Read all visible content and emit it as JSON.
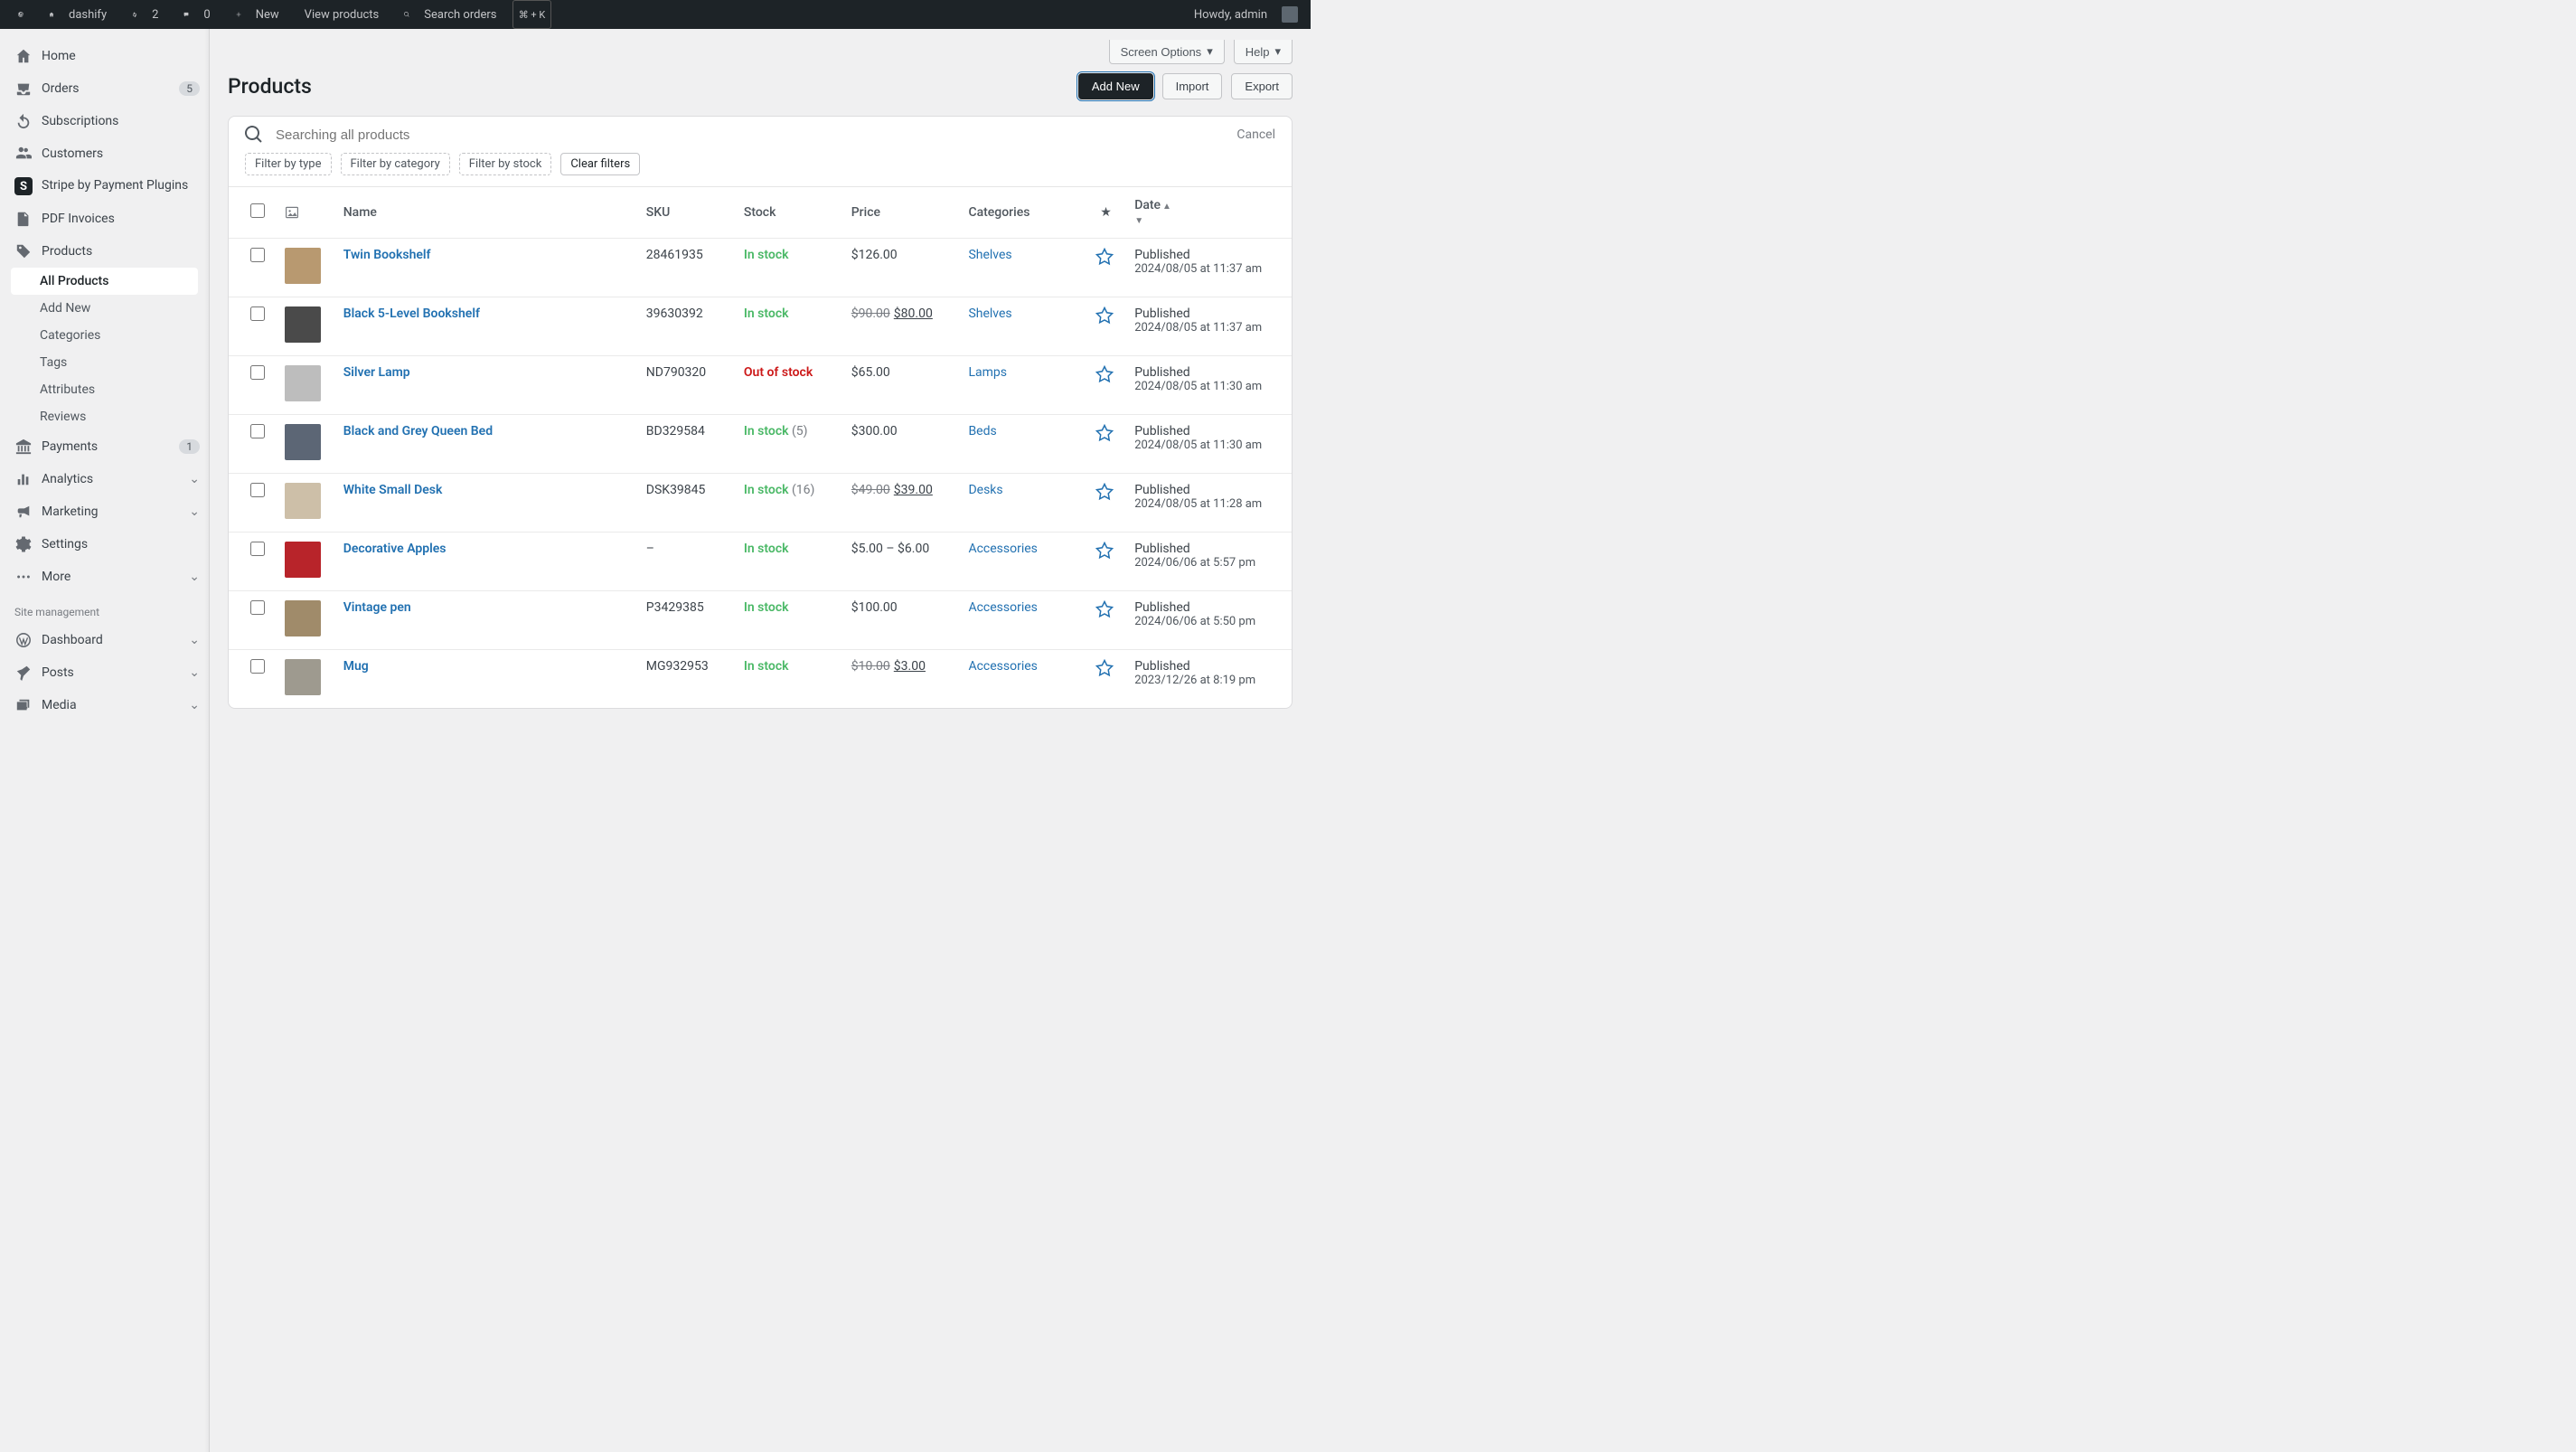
{
  "topbar": {
    "site_name": "dashify",
    "sync_count": "2",
    "comments_count": "0",
    "new_label": "New",
    "view_products": "View products",
    "search_label": "Search orders",
    "search_kbd": "⌘ + K",
    "howdy": "Howdy, admin"
  },
  "sidebar": {
    "home": "Home",
    "orders": "Orders",
    "orders_badge": "5",
    "subscriptions": "Subscriptions",
    "customers": "Customers",
    "stripe": "Stripe by Payment Plugins",
    "pdf": "PDF Invoices",
    "products": "Products",
    "sub": {
      "all": "All Products",
      "add": "Add New",
      "categories": "Categories",
      "tags": "Tags",
      "attributes": "Attributes",
      "reviews": "Reviews"
    },
    "payments": "Payments",
    "payments_badge": "1",
    "analytics": "Analytics",
    "marketing": "Marketing",
    "settings": "Settings",
    "more": "More",
    "section": "Site management",
    "dashboard": "Dashboard",
    "posts": "Posts",
    "media": "Media"
  },
  "header": {
    "screen_options": "Screen Options",
    "help": "Help",
    "title": "Products",
    "add_new": "Add New",
    "import": "Import",
    "export": "Export"
  },
  "search": {
    "placeholder": "Searching all products",
    "cancel": "Cancel"
  },
  "filters": {
    "type": "Filter by type",
    "category": "Filter by category",
    "stock": "Filter by stock",
    "clear": "Clear filters"
  },
  "columns": {
    "name": "Name",
    "sku": "SKU",
    "stock": "Stock",
    "price": "Price",
    "categories": "Categories",
    "date": "Date"
  },
  "rows": [
    {
      "name": "Twin Bookshelf",
      "sku": "28461935",
      "stock": "In stock",
      "stock_state": "in",
      "stock_qty": "",
      "price": "$126.00",
      "old_price": "",
      "categories": "Shelves",
      "published": "Published",
      "date": "2024/08/05 at 11:37 am",
      "thumb": "#b89970"
    },
    {
      "name": "Black 5-Level Bookshelf",
      "sku": "39630392",
      "stock": "In stock",
      "stock_state": "in",
      "stock_qty": "",
      "price": "$80.00",
      "old_price": "$90.00",
      "categories": "Shelves",
      "published": "Published",
      "date": "2024/08/05 at 11:37 am",
      "thumb": "#4a4a4a"
    },
    {
      "name": "Silver Lamp",
      "sku": "ND790320",
      "stock": "Out of stock",
      "stock_state": "out",
      "stock_qty": "",
      "price": "$65.00",
      "old_price": "",
      "categories": "Lamps",
      "published": "Published",
      "date": "2024/08/05 at 11:30 am",
      "thumb": "#bdbdbd"
    },
    {
      "name": "Black and Grey Queen Bed",
      "sku": "BD329584",
      "stock": "In stock",
      "stock_state": "in",
      "stock_qty": "(5)",
      "price": "$300.00",
      "old_price": "",
      "categories": "Beds",
      "published": "Published",
      "date": "2024/08/05 at 11:30 am",
      "thumb": "#5c6675"
    },
    {
      "name": "White Small Desk",
      "sku": "DSK39845",
      "stock": "In stock",
      "stock_state": "in",
      "stock_qty": "(16)",
      "price": "$39.00",
      "old_price": "$49.00",
      "categories": "Desks",
      "published": "Published",
      "date": "2024/08/05 at 11:28 am",
      "thumb": "#cdbfa8"
    },
    {
      "name": "Decorative Apples",
      "sku": "–",
      "stock": "In stock",
      "stock_state": "in",
      "stock_qty": "",
      "price": "$5.00 – $6.00",
      "old_price": "",
      "categories": "Accessories",
      "published": "Published",
      "date": "2024/06/06 at 5:57 pm",
      "thumb": "#b8242a"
    },
    {
      "name": "Vintage pen",
      "sku": "P3429385",
      "stock": "In stock",
      "stock_state": "in",
      "stock_qty": "",
      "price": "$100.00",
      "old_price": "",
      "categories": "Accessories",
      "published": "Published",
      "date": "2024/06/06 at 5:50 pm",
      "thumb": "#a08b6a"
    },
    {
      "name": "Mug",
      "sku": "MG932953",
      "stock": "In stock",
      "stock_state": "in",
      "stock_qty": "",
      "price": "$3.00",
      "old_price": "$10.00",
      "categories": "Accessories",
      "published": "Published",
      "date": "2023/12/26 at 8:19 pm",
      "thumb": "#9e9a8f"
    }
  ]
}
